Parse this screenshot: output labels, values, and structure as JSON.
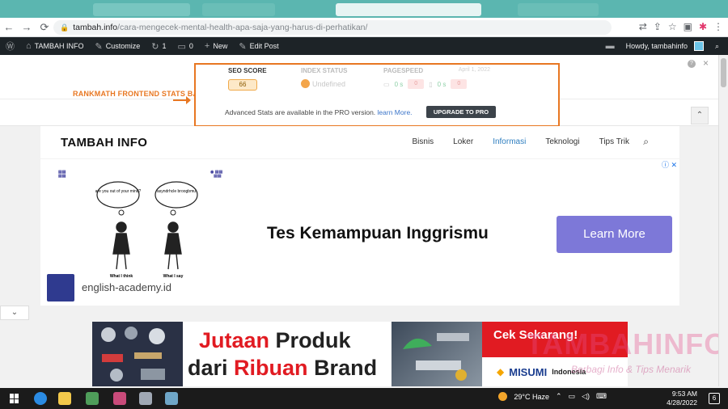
{
  "browser": {
    "url_host": "tambah.info",
    "url_path": "/cara-mengecek-mental-health-apa-saja-yang-harus-di-perhatikan/"
  },
  "adminbar": {
    "site_name": "TAMBAH INFO",
    "customize": "Customize",
    "updates": "1",
    "comments": "0",
    "new": "New",
    "edit_post": "Edit Post",
    "howdy": "Howdy, tambahinfo"
  },
  "rankmath": {
    "annotation": "RANKMATH FRONTEND STATS BAR",
    "seo_score_label": "SEO SCORE",
    "seo_score_value": "66",
    "index_status_label": "INDEX STATUS",
    "index_status_value": "Undefined",
    "pagespeed_label": "PAGESPEED",
    "pagespeed_desktop_time": "0 s",
    "pagespeed_desktop_score": "0",
    "pagespeed_mobile_time": "0 s",
    "pagespeed_mobile_score": "0",
    "date": "April 1, 2022",
    "pro_text": "Advanced Stats are available in the PRO version.",
    "learn_more": "learn More.",
    "upgrade_button": "UPGRADE TO PRO",
    "accent_color": "#e87722"
  },
  "site": {
    "brand": "TAMBAH INFO",
    "menu": [
      "Bisnis",
      "Loker",
      "Informasi",
      "Teknologi",
      "Tips Trik"
    ],
    "active_menu": "Informasi"
  },
  "ad1": {
    "headline": "Tes Kemampuan Inggrismu",
    "cta": "Learn More",
    "domain": "english-academy.id",
    "bubble_left": "are you out of your mind?",
    "bubble_right": "asyndrhcle broogbmu",
    "caption_left": "What I think",
    "caption_right": "What I say"
  },
  "ad2": {
    "line1_a": "Jutaan",
    "line1_b": "Produk",
    "line2_a": "dari",
    "line2_b": "Ribuan",
    "line2_c": "Brand",
    "cta": "Cek Sekarang!",
    "brand": "MISUMI",
    "region": "Indonesia"
  },
  "watermark": {
    "title": "TAMBAHINFO",
    "subtitle": "Berbagi Info & Tips Menarik"
  },
  "taskbar": {
    "weather": "29°C Haze",
    "time": "9:53 AM",
    "date": "4/28/2022",
    "notifications": "6"
  }
}
